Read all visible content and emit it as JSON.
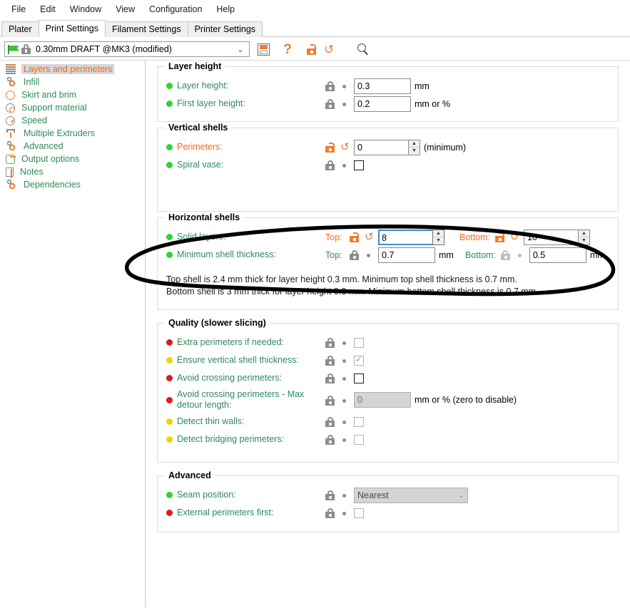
{
  "menubar": {
    "items": [
      "File",
      "Edit",
      "Window",
      "View",
      "Configuration",
      "Help"
    ]
  },
  "tabs": [
    {
      "label": "Plater",
      "active": false
    },
    {
      "label": "Print Settings",
      "active": true
    },
    {
      "label": "Filament Settings",
      "active": false
    },
    {
      "label": "Printer Settings",
      "active": false
    }
  ],
  "preset": {
    "value": "0.30mm DRAFT @MK3 (modified)",
    "flag_icon": "green-flag-icon",
    "lock_icon": "lock-icon",
    "arrow": "⌄"
  },
  "toolbar": {
    "save_icon": "save-icon",
    "help_icon": "question-mark-icon",
    "unlock_icon": "unlock-icon",
    "revert_icon": "revert-arrow-icon",
    "search_icon": "search-icon",
    "help_glyph": "?"
  },
  "sidebar": {
    "items": [
      {
        "label": "Layers and perimeters",
        "icon": "layers-icon",
        "active": true
      },
      {
        "label": "Infill",
        "icon": "infill-icon",
        "active": false
      },
      {
        "label": "Skirt and brim",
        "icon": "skirt-icon",
        "active": false
      },
      {
        "label": "Support material",
        "icon": "support-icon",
        "active": false
      },
      {
        "label": "Speed",
        "icon": "speed-icon",
        "active": false
      },
      {
        "label": "Multiple Extruders",
        "icon": "extruder-icon",
        "active": false
      },
      {
        "label": "Advanced",
        "icon": "gears-icon",
        "active": false
      },
      {
        "label": "Output options",
        "icon": "output-icon",
        "active": false
      },
      {
        "label": "Notes",
        "icon": "notes-icon",
        "active": false
      },
      {
        "label": "Dependencies",
        "icon": "gears-icon",
        "active": false
      }
    ]
  },
  "groups": {
    "layer_height": {
      "title": "Layer height",
      "rows": [
        {
          "label": "Layer height:",
          "value": "0.3",
          "units": "mm"
        },
        {
          "label": "First layer height:",
          "value": "0.2",
          "units": "mm or %"
        }
      ]
    },
    "vertical_shells": {
      "title": "Vertical shells",
      "perimeters_label": "Perimeters:",
      "perimeters_value": "0",
      "perimeters_units": "(minimum)",
      "spiral_vase_label": "Spiral vase:"
    },
    "horizontal_shells": {
      "title": "Horizontal shells",
      "solid_layers_label": "Solid layers:",
      "solid_top_label": "Top:",
      "solid_top_value": "8",
      "solid_bottom_label": "Bottom:",
      "solid_bottom_value": "10",
      "min_thickness_label": "Minimum shell thickness:",
      "min_top_label": "Top:",
      "min_top_value": "0.7",
      "min_top_units": "mm",
      "min_bottom_label": "Bottom:",
      "min_bottom_value": "0.5",
      "min_bottom_units": "mm",
      "description_line1": "Top shell is 2.4 mm thick for layer height 0.3 mm. Minimum top shell thickness is 0.7 mm.",
      "description_line2": "Bottom shell is 3 mm thick for layer height 0.3 mm. Minimum bottom shell thickness is 0.7 mm."
    },
    "quality": {
      "title": "Quality (slower slicing)",
      "rows": [
        {
          "label": "Extra perimeters if needed:",
          "bullet": "red"
        },
        {
          "label": "Ensure vertical shell thickness:",
          "bullet": "yellow"
        },
        {
          "label": "Avoid crossing perimeters:",
          "bullet": "red"
        },
        {
          "label": "Avoid crossing perimeters - Max detour length:",
          "bullet": "red",
          "value": "0",
          "units": "mm or % (zero to disable)"
        },
        {
          "label": "Detect thin walls:",
          "bullet": "yellow"
        },
        {
          "label": "Detect bridging perimeters:",
          "bullet": "yellow"
        }
      ]
    },
    "advanced": {
      "title": "Advanced",
      "seam_label": "Seam position:",
      "seam_value": "Nearest",
      "external_label": "External perimeters first:"
    }
  },
  "annotation": {
    "shape": "hand-drawn-ellipse",
    "color": "#000000"
  },
  "colors": {
    "accent_orange": "#ee6c1e",
    "label_green": "#2e8b57",
    "bullet_green": "#31d431",
    "bullet_yellow": "#f5d106",
    "bullet_red": "#e11919",
    "focus_blue": "#3a8fd4"
  }
}
